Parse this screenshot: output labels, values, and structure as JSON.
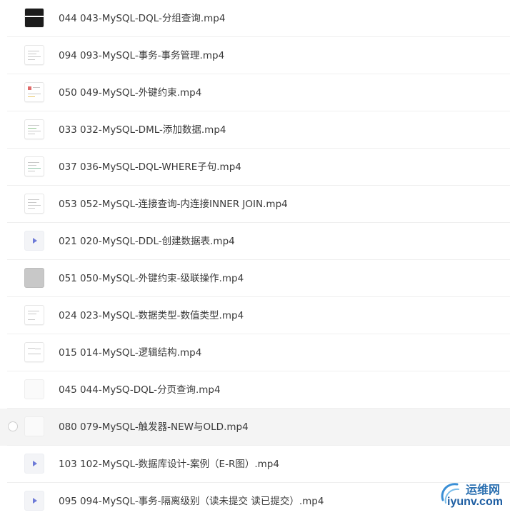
{
  "files": [
    {
      "name": "044 043-MySQL-DQL-分组查询.mp4",
      "thumb": "dark"
    },
    {
      "name": "094 093-MySQL-事务-事务管理.mp4",
      "thumb": "doc"
    },
    {
      "name": "050 049-MySQL-外键约束.mp4",
      "thumb": "doc"
    },
    {
      "name": "033 032-MySQL-DML-添加数据.mp4",
      "thumb": "doc"
    },
    {
      "name": "037 036-MySQL-DQL-WHERE子句.mp4",
      "thumb": "doc"
    },
    {
      "name": "053 052-MySQL-连接查询-内连接INNER JOIN.mp4",
      "thumb": "doc"
    },
    {
      "name": "021 020-MySQL-DDL-创建数据表.mp4",
      "thumb": "play"
    },
    {
      "name": "051 050-MySQL-外键约束-级联操作.mp4",
      "thumb": "grey"
    },
    {
      "name": "024 023-MySQL-数据类型-数值类型.mp4",
      "thumb": "doc"
    },
    {
      "name": "015 014-MySQL-逻辑结构.mp4",
      "thumb": "doc"
    },
    {
      "name": "045 044-MySQ-DQL-分页查询.mp4",
      "thumb": "blank"
    },
    {
      "name": "080 079-MySQL-触发器-NEW与OLD.mp4",
      "thumb": "blank"
    },
    {
      "name": "103 102-MySQL-数据库设计-案例（E-R图）.mp4",
      "thumb": "play"
    },
    {
      "name": "095 094-MySQL-事务-隔离级别（读未提交 读已提交）.mp4",
      "thumb": "play"
    }
  ],
  "watermark": {
    "cn": "运维网",
    "en": "iyunv.com"
  },
  "colors": {
    "hover_row": "#f4f4f4",
    "divider": "#efefef",
    "play_icon": "#6e7bd8",
    "watermark": "#2a6fb0"
  }
}
